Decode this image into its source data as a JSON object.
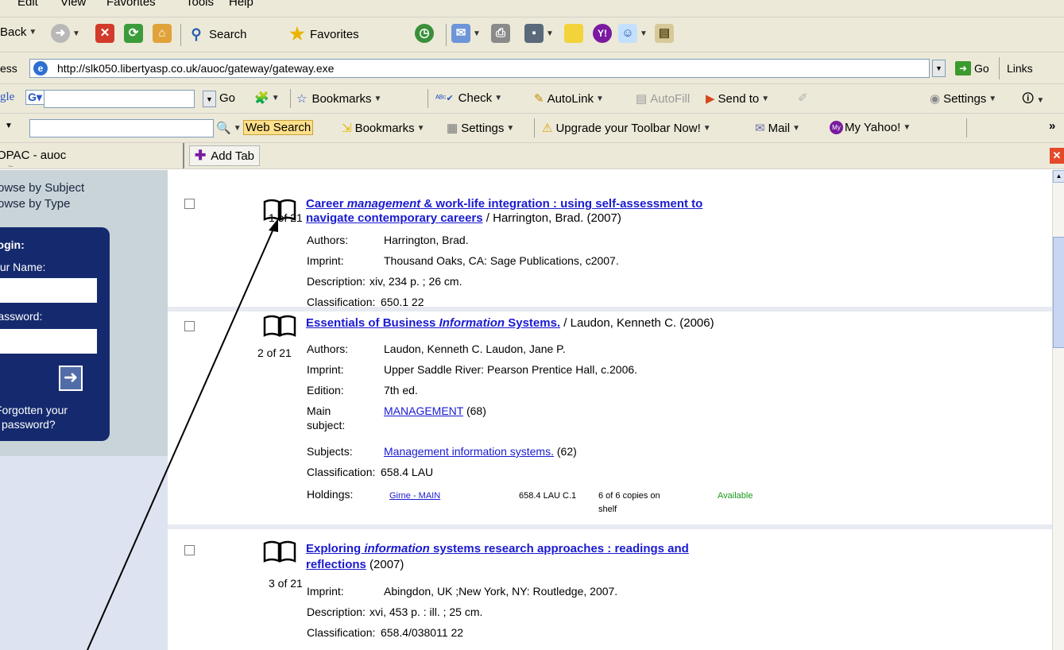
{
  "browser": {
    "menu": [
      "Edit",
      "View",
      "Favorites",
      "Tools",
      "Help"
    ],
    "toolbar": {
      "back": "Back",
      "search": "Search",
      "favorites": "Favorites"
    },
    "address": {
      "label": "Address",
      "url": "http://slk050.libertyasp.co.uk/auoc/gateway/gateway.exe",
      "go": "Go",
      "links": "Links"
    },
    "google_bar": {
      "logo": "Google",
      "go": "Go",
      "bookmarks": "Bookmarks",
      "check": "Check",
      "autolink": "AutoLink",
      "autofill": "AutoFill",
      "send_to": "Send to",
      "settings": "Settings"
    },
    "yahoo_bar": {
      "web_search": "Web Search",
      "bookmarks": "Bookmarks",
      "settings": "Settings",
      "upgrade": "Upgrade your Toolbar Now!",
      "mail": "Mail",
      "my_yahoo": "My Yahoo!",
      "more": "»"
    },
    "tabs": {
      "current": "OPAC - auoc",
      "add_tab": "Add Tab"
    }
  },
  "sidebar": {
    "links": [
      "Browse by Subject",
      "Browse by Type"
    ],
    "login": {
      "heading": "Login:",
      "user_label": "Your Name:",
      "password_label": "Password:",
      "forgot": [
        "Forgotten your",
        "password?"
      ]
    }
  },
  "results": [
    {
      "index": "1 of 21",
      "title_parts": [
        "Career ",
        "management",
        " & work-life integration : using self-assessment to",
        "navigate contemporary careers"
      ],
      "author_suffix": " / Harrington, Brad.  (2007)",
      "fields": [
        {
          "k": "Authors:",
          "v": "Harrington, Brad."
        },
        {
          "k": "Imprint:",
          "v": "Thousand Oaks, CA: Sage Publications, c2007."
        },
        {
          "k": "Description:",
          "v": "xiv, 234 p. ; 26 cm."
        },
        {
          "k": "Classification:",
          "v": "650.1 22"
        }
      ]
    },
    {
      "index": "2 of 21",
      "title_parts": [
        "Essentials of Business ",
        "Information",
        " Systems."
      ],
      "author_suffix": " / Laudon, Kenneth C.  (2006)",
      "fields": [
        {
          "k": "Authors:",
          "v": "Laudon, Kenneth C.  Laudon, Jane P."
        },
        {
          "k": "Imprint:",
          "v": "Upper Saddle River: Pearson Prentice Hall, c.2006."
        },
        {
          "k": "Edition:",
          "v": "7th ed."
        },
        {
          "k": "Main",
          "k2": "subject:",
          "link": "MANAGEMENT",
          "count": " (68)"
        },
        {
          "k": "Subjects:",
          "link": "Management information systems.",
          "count": " (62)"
        },
        {
          "k": "Classification:",
          "v": "658.4 LAU"
        }
      ],
      "holdings": {
        "label": "Holdings:",
        "location": "Girne - MAIN",
        "callno": "658.4 LAU C.1",
        "copies": [
          "6 of 6 copies on",
          "shelf"
        ],
        "status": "Available",
        "status_color": "#1a9a1a"
      }
    },
    {
      "index": "3 of 21",
      "title_parts": [
        "Exploring ",
        "information",
        " systems research approaches : readings and",
        "reflections"
      ],
      "author_suffix": " (2007)",
      "fields": [
        {
          "k": "Imprint:",
          "v": "Abingdon, UK ;New York, NY: Routledge, 2007."
        },
        {
          "k": "Description:",
          "v": "xvi, 453 p. : ill. ; 25 cm."
        },
        {
          "k": "Classification:",
          "v": "658.4/038011 22"
        }
      ]
    }
  ],
  "colors": {
    "link": "#1a1ad1",
    "chrome": "#ece9d8",
    "login_panel": "#152a6e",
    "sidebar": "#c9d4d8"
  }
}
